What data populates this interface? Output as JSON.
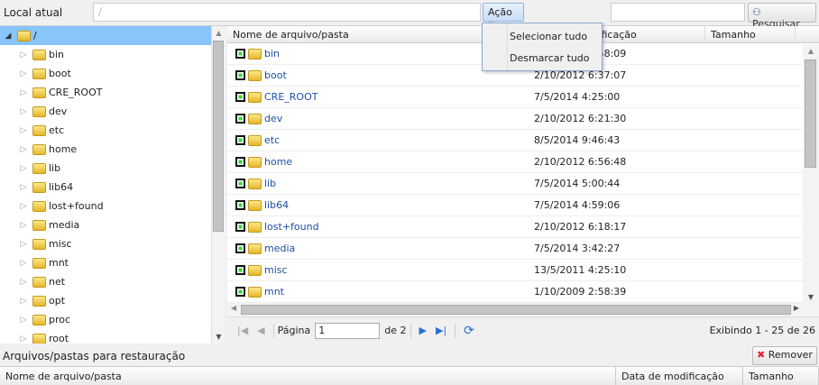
{
  "toolbar": {
    "location_label": "Local atual",
    "path_value": "/",
    "action_label": "Ação",
    "search_value": "",
    "search_label": "Pesquisar"
  },
  "action_menu": [
    "Selecionar tudo",
    "Desmarcar tudo"
  ],
  "tree": {
    "root": "/",
    "items": [
      "bin",
      "boot",
      "CRE_ROOT",
      "dev",
      "etc",
      "home",
      "lib",
      "lib64",
      "lost+found",
      "media",
      "misc",
      "mnt",
      "net",
      "opt",
      "proc",
      "root"
    ]
  },
  "grid": {
    "columns": [
      "Nome de arquivo/pasta",
      "Data de modificação",
      "Tamanho"
    ],
    "rows": [
      {
        "name": "bin",
        "date": "1/10/2009 2:58:09"
      },
      {
        "name": "boot",
        "date": "2/10/2012 6:37:07"
      },
      {
        "name": "CRE_ROOT",
        "date": "7/5/2014 4:25:00"
      },
      {
        "name": "dev",
        "date": "2/10/2012 6:21:30"
      },
      {
        "name": "etc",
        "date": "8/5/2014 9:46:43"
      },
      {
        "name": "home",
        "date": "2/10/2012 6:56:48"
      },
      {
        "name": "lib",
        "date": "7/5/2014 5:00:44"
      },
      {
        "name": "lib64",
        "date": "7/5/2014 4:59:06"
      },
      {
        "name": "lost+found",
        "date": "2/10/2012 6:18:17"
      },
      {
        "name": "media",
        "date": "7/5/2014 3:42:27"
      },
      {
        "name": "misc",
        "date": "13/5/2011 4:25:10"
      },
      {
        "name": "mnt",
        "date": "1/10/2009 2:58:39"
      }
    ]
  },
  "pager": {
    "page_label": "Página",
    "page": "1",
    "of_label": "de 2",
    "display": "Exibindo 1 - 25 de 26"
  },
  "restore": {
    "label": "Arquivos/pastas para restauração",
    "remove_label": "Remover",
    "columns": [
      "Nome de arquivo/pasta",
      "Data de modificação",
      "Tamanho"
    ]
  }
}
